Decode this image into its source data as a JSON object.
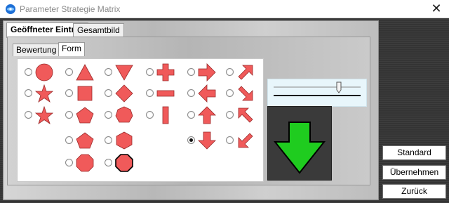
{
  "window": {
    "title": "Parameter Strategie Matrix",
    "close_glyph": "✕"
  },
  "tabs": [
    {
      "label": "Geöffneter Eintrag",
      "active": true
    },
    {
      "label": "Gesamtbild",
      "active": false
    }
  ],
  "subtabs": [
    {
      "label": "Bewertung",
      "active": false
    },
    {
      "label": "Form",
      "active": true
    }
  ],
  "shapes": {
    "color": "#f05a5a",
    "options": [
      {
        "icon": "circle-icon",
        "selected": false
      },
      {
        "icon": "star-icon",
        "selected": false
      },
      {
        "icon": "star-icon",
        "selected": false
      },
      {
        "icon": "triangle-up-icon",
        "selected": false
      },
      {
        "icon": "square-icon",
        "selected": false
      },
      {
        "icon": "pentagon-icon",
        "selected": false
      },
      {
        "icon": "pentagon-icon",
        "selected": false
      },
      {
        "icon": "octagon-icon",
        "selected": false
      },
      {
        "icon": "triangle-down-icon",
        "selected": false
      },
      {
        "icon": "diamond-icon",
        "selected": false
      },
      {
        "icon": "heptagon-icon",
        "selected": false
      },
      {
        "icon": "hexagon-icon",
        "selected": false
      },
      {
        "icon": "octagon-icon",
        "selected": false
      },
      {
        "icon": "plus-icon",
        "selected": false
      },
      {
        "icon": "minus-icon",
        "selected": false
      },
      {
        "icon": "vertical-bar-icon",
        "selected": false
      },
      {
        "icon": "arrow-right-icon",
        "selected": false
      },
      {
        "icon": "arrow-left-icon",
        "selected": false
      },
      {
        "icon": "arrow-up-icon",
        "selected": false
      },
      {
        "icon": "arrow-down-icon",
        "selected": true
      },
      {
        "icon": "arrow-up-right-icon",
        "selected": false
      },
      {
        "icon": "arrow-down-right-icon",
        "selected": false
      },
      {
        "icon": "arrow-up-left-icon",
        "selected": false
      },
      {
        "icon": "arrow-down-left-icon",
        "selected": false
      }
    ]
  },
  "size_slider": {
    "value_fraction": 0.75
  },
  "preview": {
    "icon": "arrow-down-icon",
    "color": "#1fcc1f"
  },
  "buttons": {
    "standard": "Standard",
    "apply": "Übernehmen",
    "back": "Zurück"
  }
}
